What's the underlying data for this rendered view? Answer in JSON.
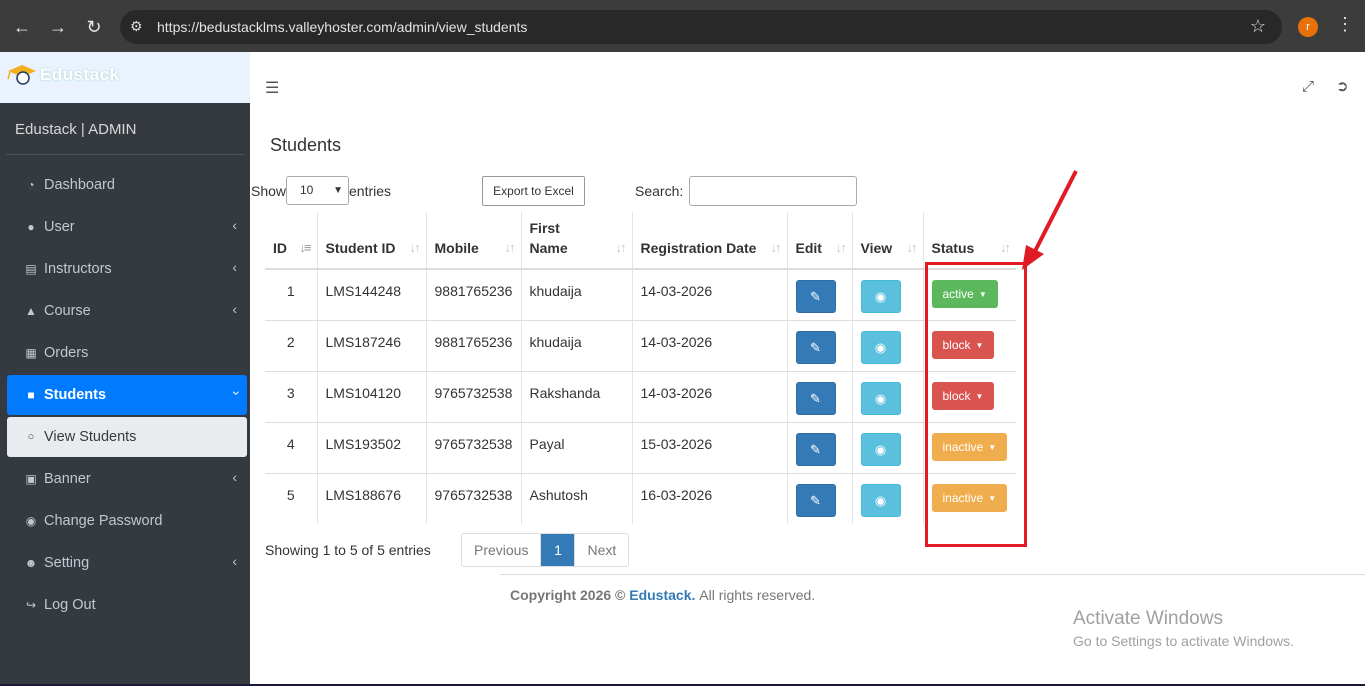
{
  "browser": {
    "url": "https://bedustacklms.valleyhoster.com/admin/view_students",
    "avatar_letter": "r"
  },
  "sidebar": {
    "brand": "Edustack",
    "admin_title": "Edustack | ADMIN",
    "items": [
      {
        "label": "Dashboard",
        "icon": "dashboard-icon",
        "chevron": false
      },
      {
        "label": "User",
        "icon": "user-icon",
        "chevron": true
      },
      {
        "label": "Instructors",
        "icon": "instructor-icon",
        "chevron": true
      },
      {
        "label": "Course",
        "icon": "graduation-cap-icon",
        "chevron": true
      },
      {
        "label": "Orders",
        "icon": "calendar-icon",
        "chevron": false
      },
      {
        "label": "Students",
        "icon": "student-icon",
        "chevron": true,
        "active": true
      },
      {
        "label": "View Students",
        "icon": "circle-icon",
        "chevron": false,
        "sub": true
      },
      {
        "label": "Banner",
        "icon": "image-icon",
        "chevron": true
      },
      {
        "label": "Change Password",
        "icon": "toggle-icon",
        "chevron": false
      },
      {
        "label": "Setting",
        "icon": "user-gear-icon",
        "chevron": true
      },
      {
        "label": "Log Out",
        "icon": "logout-icon",
        "chevron": false
      }
    ]
  },
  "main": {
    "title": "Students",
    "show_label": "Show",
    "entries_value": "10",
    "entries_label": "entries",
    "export_label": "Export to Excel",
    "search_label": "Search:"
  },
  "table": {
    "headers": [
      "ID",
      "Student ID",
      "Mobile",
      "First Name",
      "Registration Date",
      "Edit",
      "View",
      "Status"
    ],
    "rows": [
      {
        "id": "1",
        "student_id": "LMS144248",
        "mobile": "9881765236",
        "first_name": "khudaija",
        "reg_date": "14-03-2026",
        "status": "active"
      },
      {
        "id": "2",
        "student_id": "LMS187246",
        "mobile": "9881765236",
        "first_name": "khudaija",
        "reg_date": "14-03-2026",
        "status": "block"
      },
      {
        "id": "3",
        "student_id": "LMS104120",
        "mobile": "9765732538",
        "first_name": "Rakshanda",
        "reg_date": "14-03-2026",
        "status": "block"
      },
      {
        "id": "4",
        "student_id": "LMS193502",
        "mobile": "9765732538",
        "first_name": "Payal",
        "reg_date": "15-03-2026",
        "status": "inactive"
      },
      {
        "id": "5",
        "student_id": "LMS188676",
        "mobile": "9765732538",
        "first_name": "Ashutosh",
        "reg_date": "16-03-2026",
        "status": "inactive"
      }
    ]
  },
  "status_colors": {
    "active": "#5cb85c",
    "block": "#d9534f",
    "inactive": "#f0ad4e"
  },
  "pagination": {
    "showing": "Showing 1 to 5 of 5 entries",
    "previous": "Previous",
    "current": "1",
    "next": "Next"
  },
  "footer": {
    "prefix": "Copyright 2026 ©",
    "brand": "Edustack.",
    "suffix": "All rights reserved."
  },
  "watermark": {
    "line1": "Activate Windows",
    "line2": "Go to Settings to activate Windows."
  }
}
